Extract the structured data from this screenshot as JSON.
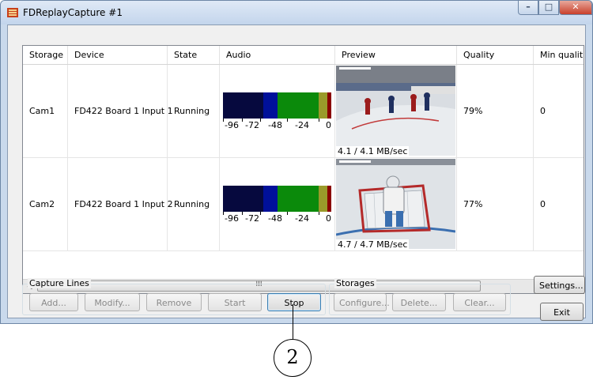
{
  "window": {
    "title": "FDReplayCapture #1"
  },
  "grid": {
    "columns": [
      "Storage",
      "Device",
      "State",
      "Audio",
      "Preview",
      "Quality",
      "Min qualit"
    ],
    "rows": [
      {
        "storage": "Cam1",
        "device": "FD422 Board 1 Input 1",
        "state": "Running",
        "preview_rate": "4.1 / 4.1 MB/sec",
        "quality": "79%",
        "min_quality": "0"
      },
      {
        "storage": "Cam2",
        "device": "FD422 Board 1 Input 2",
        "state": "Running",
        "preview_rate": "4.7 / 4.7 MB/sec",
        "quality": "77%",
        "min_quality": "0"
      }
    ],
    "audio_scale": [
      "-96",
      "-72",
      "-48",
      "-24",
      "0"
    ],
    "scroll_thumb_grip": "III"
  },
  "capture_lines": {
    "label": "Capture Lines",
    "buttons": {
      "add": "Add...",
      "modify": "Modify...",
      "remove": "Remove",
      "start": "Start",
      "stop": "Stop"
    }
  },
  "storages": {
    "label": "Storages",
    "buttons": {
      "configure": "Configure...",
      "delete": "Delete...",
      "clear": "Clear..."
    }
  },
  "side": {
    "settings": "Settings...",
    "exit": "Exit"
  },
  "callout": {
    "number": "2"
  },
  "colors": {
    "meter_dark": "#06093e",
    "meter_blue": "#00109a",
    "meter_green": "#0b8a0b",
    "meter_olive": "#9a9a2a",
    "meter_red": "#8b0000"
  }
}
